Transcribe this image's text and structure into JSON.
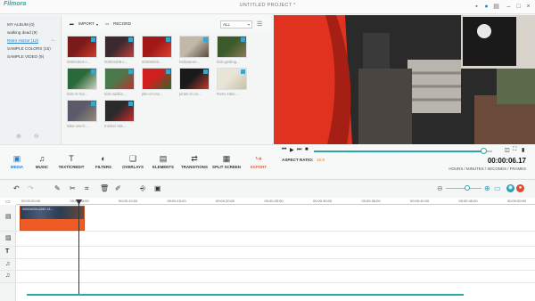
{
  "app": {
    "logo_text": "Filmora",
    "title": "UNTITLED PROJECT *"
  },
  "album": {
    "items": [
      {
        "label": "MY ALBUM (0)",
        "active": false
      },
      {
        "label": "walking dead (9)",
        "active": false
      },
      {
        "label": "Retro Horror (12)",
        "active": true
      },
      {
        "label": "SAMPLE COLORS (15)",
        "active": false
      },
      {
        "label": "SAMPLE VIDEO (9)",
        "active": false
      }
    ]
  },
  "media_toolbar": {
    "import_label": "IMPORT",
    "record_label": "RECORD",
    "filter_value": "ALL"
  },
  "media": [
    {
      "caption": "00004404-c...",
      "palette": [
        "#7a1a1a",
        "#d43a2a"
      ]
    },
    {
      "caption": "00004408-c...",
      "palette": [
        "#3a2a30",
        "#c04040"
      ]
    },
    {
      "caption": "00005003...",
      "palette": [
        "#a01818",
        "#e04030"
      ]
    },
    {
      "caption": "halloween-...",
      "palette": [
        "#c0b8a8",
        "#5a4a40"
      ]
    },
    {
      "caption": "kids-getting...",
      "palette": [
        "#3a5a2a",
        "#8a7a5a"
      ]
    },
    {
      "caption": "kids-in-hal...",
      "palette": [
        "#2a6a3a",
        "#d0d0c0"
      ]
    },
    {
      "caption": "kids-walkin...",
      "palette": [
        "#4a7a4a",
        "#c03030"
      ]
    },
    {
      "caption": "pile-of-can...",
      "palette": [
        "#d02020",
        "#2a6a2a"
      ]
    },
    {
      "caption": "pirate-in-ce...",
      "palette": [
        "#1a1a1a",
        "#c03a2a"
      ]
    },
    {
      "caption": "Retro Halo...",
      "palette": [
        "#e8e4d8",
        "#c8c0a8"
      ]
    },
    {
      "caption": "take-one-h...",
      "palette": [
        "#5a5a6a",
        "#9a8a7a"
      ]
    },
    {
      "caption": "trunker-sta...",
      "palette": [
        "#2a2a2a",
        "#d02a2a"
      ]
    }
  ],
  "playback": {
    "aspect_label": "ASPECT RATIO:",
    "aspect_value": "16:9",
    "timecode": "00:00:06.17",
    "timecode_sub": "HOURS / MINUTES / SECONDS / FRAMES",
    "progress": 0.95
  },
  "tools": [
    {
      "label": "MEDIA",
      "icon": "media-icon",
      "glyph": "▣",
      "active": true
    },
    {
      "label": "MUSIC",
      "icon": "music-icon",
      "glyph": "♫"
    },
    {
      "label": "TEXT/CREDIT",
      "icon": "text-icon",
      "glyph": "T"
    },
    {
      "label": "FILTERS",
      "icon": "filters-icon",
      "glyph": "◐"
    },
    {
      "label": "OVERLAYS",
      "icon": "overlays-icon",
      "glyph": "❏"
    },
    {
      "label": "ELEMENTS",
      "icon": "elements-icon",
      "glyph": "▤"
    },
    {
      "label": "TRANSITIONS",
      "icon": "transitions-icon",
      "glyph": "⇄"
    },
    {
      "label": "SPLIT SCREEN",
      "icon": "split-screen-icon",
      "glyph": "▦"
    },
    {
      "label": "EXPORT",
      "icon": "export-icon",
      "glyph": "↪",
      "export": true
    }
  ],
  "timeline": {
    "ticks": [
      "00:00:00:00",
      "00:00:05:00",
      "00:00:10:00",
      "00:00:15:00",
      "00:00:20:00",
      "00:00:25:00",
      "00:00:30:00",
      "00:00:35:00",
      "00:00:40:00",
      "00:00:45:00",
      "00:00:50:00"
    ],
    "clip_label": "00004404-c2d2-41...",
    "zoom_level": 0.6
  },
  "colors": {
    "accent": "#2aa8a8",
    "export": "#e0653a",
    "clip": "#f05a24"
  }
}
